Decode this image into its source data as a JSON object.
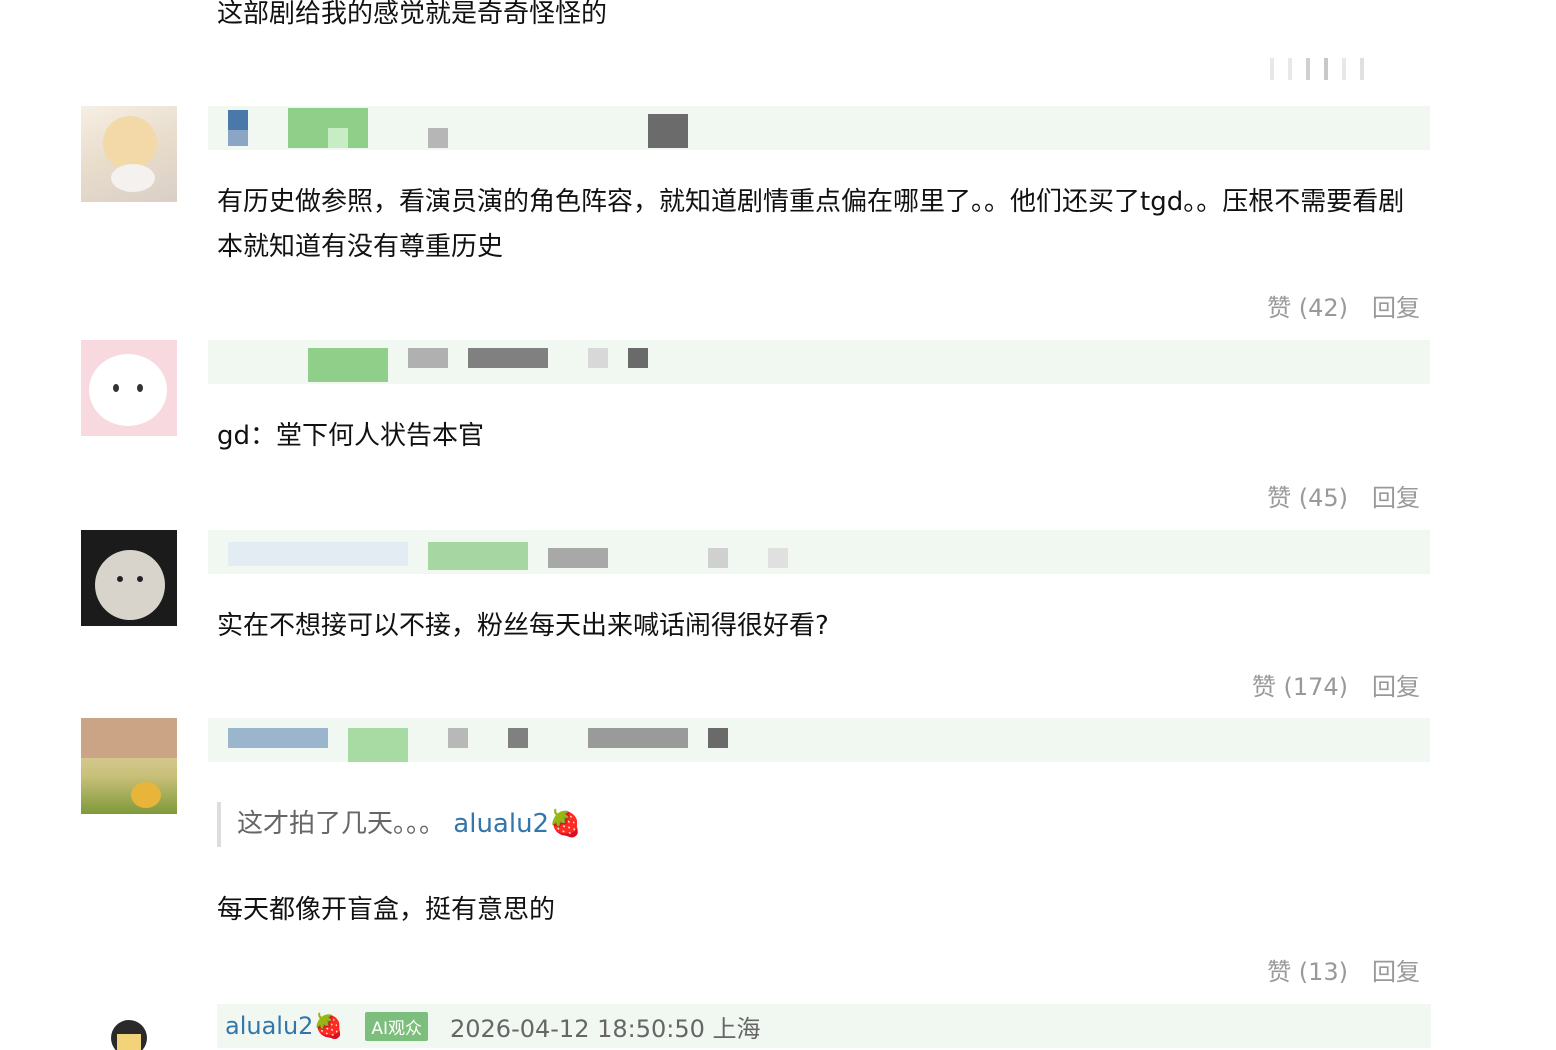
{
  "top_comment": {
    "text": "这部剧给我的感觉就是奇奇怪怪的"
  },
  "comments": [
    {
      "text": "有历史做参照，看演员演的角色阵容，就知道剧情重点偏在哪里了。。他们还买了tgd。。压根不需要看剧本就知道有没有尊重历史",
      "like_label": "赞 (42)",
      "reply_label": "回复"
    },
    {
      "text": "gd：堂下何人状告本官",
      "like_label": "赞 (45)",
      "reply_label": "回复"
    },
    {
      "text": "实在不想接可以不接，粉丝每天出来喊话闹得很好看?",
      "like_label": "赞 (174)",
      "reply_label": "回复"
    },
    {
      "quote_text": "这才拍了几天。。。",
      "quote_user": "alualu2🍓",
      "text": "每天都像开盲盒，挺有意思的",
      "like_label": "赞 (13)",
      "reply_label": "回复"
    }
  ],
  "last_meta": {
    "username": "alualu2🍓",
    "badge": "AI观众",
    "timestamp": "2026-04-12 18:50:50 上海"
  }
}
